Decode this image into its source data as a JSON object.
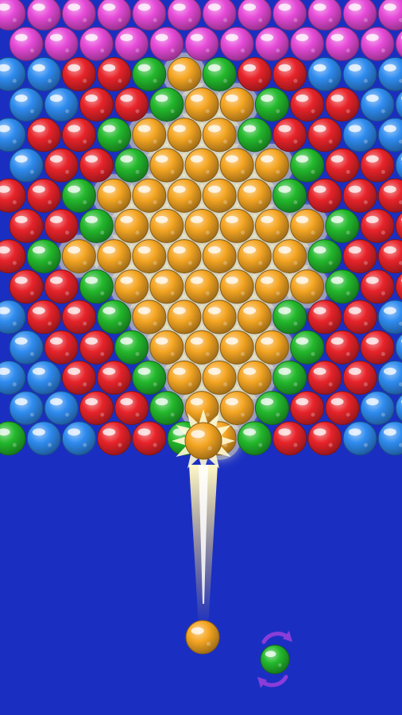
{
  "game": {
    "background_color": "#1a2fc2",
    "color_palette": {
      "magenta": "#e64ad8",
      "blue": "#2f8cf0",
      "red": "#e8232a",
      "green": "#23b92c",
      "gold": "#f5a623"
    },
    "grid_rows": [
      [
        "magenta",
        "magenta",
        "magenta",
        "magenta",
        "magenta",
        "magenta",
        "magenta",
        "magenta",
        "magenta",
        "magenta",
        "magenta",
        "magenta"
      ],
      [
        "magenta",
        "magenta",
        "magenta",
        "magenta",
        "magenta",
        "magenta",
        "magenta",
        "magenta",
        "magenta",
        "magenta",
        "magenta",
        "magenta"
      ],
      [
        "blue",
        "blue",
        "red",
        "red",
        "green",
        "gold",
        "green",
        "red",
        "red",
        "blue",
        "blue",
        "blue"
      ],
      [
        "blue",
        "blue",
        "red",
        "red",
        "green",
        "gold",
        "gold",
        "green",
        "red",
        "red",
        "blue",
        "blue"
      ],
      [
        "blue",
        "red",
        "red",
        "green",
        "gold",
        "gold",
        "gold",
        "green",
        "red",
        "red",
        "blue",
        "blue"
      ],
      [
        "blue",
        "red",
        "red",
        "green",
        "gold",
        "gold",
        "gold",
        "gold",
        "green",
        "red",
        "red",
        "blue"
      ],
      [
        "red",
        "red",
        "green",
        "gold",
        "gold",
        "gold",
        "gold",
        "gold",
        "green",
        "red",
        "red",
        "red"
      ],
      [
        "red",
        "red",
        "green",
        "gold",
        "gold",
        "gold",
        "gold",
        "gold",
        "gold",
        "green",
        "red",
        "red"
      ],
      [
        "red",
        "green",
        "gold",
        "gold",
        "gold",
        "gold",
        "gold",
        "gold",
        "gold",
        "green",
        "red",
        "red"
      ],
      [
        "red",
        "red",
        "green",
        "gold",
        "gold",
        "gold",
        "gold",
        "gold",
        "gold",
        "green",
        "red",
        "red"
      ],
      [
        "blue",
        "red",
        "red",
        "green",
        "gold",
        "gold",
        "gold",
        "gold",
        "green",
        "red",
        "red",
        "blue"
      ],
      [
        "blue",
        "red",
        "red",
        "green",
        "gold",
        "gold",
        "gold",
        "gold",
        "green",
        "red",
        "red",
        "blue"
      ],
      [
        "blue",
        "blue",
        "red",
        "red",
        "green",
        "gold",
        "gold",
        "gold",
        "green",
        "red",
        "red",
        "blue"
      ],
      [
        "blue",
        "blue",
        "red",
        "red",
        "green",
        "gold",
        "gold",
        "green",
        "red",
        "red",
        "blue",
        "blue"
      ],
      [
        "green",
        "blue",
        "blue",
        "red",
        "red",
        "green",
        "gold",
        "green",
        "red",
        "red",
        "blue",
        "blue"
      ]
    ],
    "launcher": {
      "current_ball": "gold",
      "next_ball": "green",
      "swap_icon": "swap-arrows-icon"
    },
    "impact_effect": "starburst"
  }
}
